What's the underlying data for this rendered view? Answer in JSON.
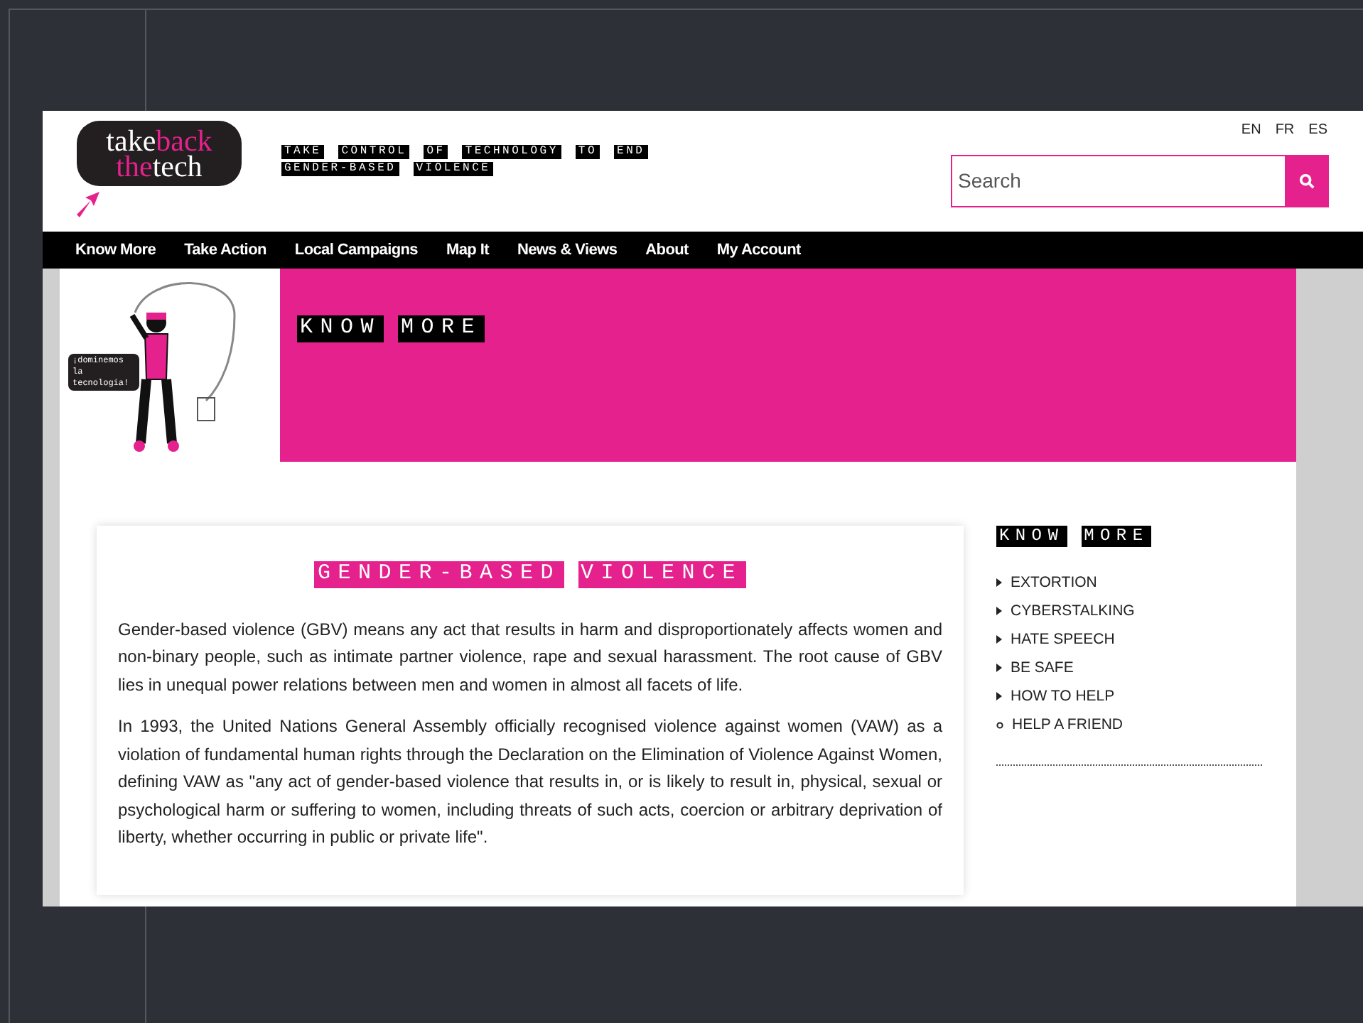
{
  "header": {
    "logo": {
      "line_1": [
        "take",
        "back"
      ],
      "line_2": [
        "the",
        "tech"
      ]
    },
    "tagline": "TAKE CONTROL OF TECHNOLOGY TO END GENDER-BASED VIOLENCE",
    "languages": [
      "EN",
      "FR",
      "ES"
    ],
    "search": {
      "placeholder": "Search"
    }
  },
  "nav": [
    "Know More",
    "Take Action",
    "Local Campaigns",
    "Map It",
    "News & Views",
    "About",
    "My Account"
  ],
  "banner": {
    "badge": "¡dominemos la tecnología!",
    "title": "KNOW MORE"
  },
  "article": {
    "title": "GENDER-BASED VIOLENCE",
    "paragraphs": [
      "Gender-based violence (GBV) means any act that results in harm and disproportionately affects women and non-binary people, such as intimate partner violence, rape and sexual harassment. The root cause of GBV lies in unequal power relations between men and women in almost all facets of life.",
      "In 1993, the United Nations General Assembly officially recognised violence against women (VAW) as a violation of fundamental human rights through the Declaration on the Elimination of Violence Against Women, defining VAW as \"any act of gender-based violence that results in, or is likely to result in, physical, sexual or psychological harm or suffering to women, including threats of such acts, coercion or arbitrary deprivation of liberty, whether occurring in public or private life\"."
    ]
  },
  "sidebar": {
    "title": "KNOW MORE",
    "items": [
      {
        "label": "EXTORTION",
        "kind": "arrow"
      },
      {
        "label": "CYBERSTALKING",
        "kind": "arrow"
      },
      {
        "label": "HATE SPEECH",
        "kind": "arrow"
      },
      {
        "label": "BE SAFE",
        "kind": "arrow"
      },
      {
        "label": "HOW TO HELP",
        "kind": "arrow"
      },
      {
        "label": "HELP A FRIEND",
        "kind": "circle"
      }
    ]
  }
}
